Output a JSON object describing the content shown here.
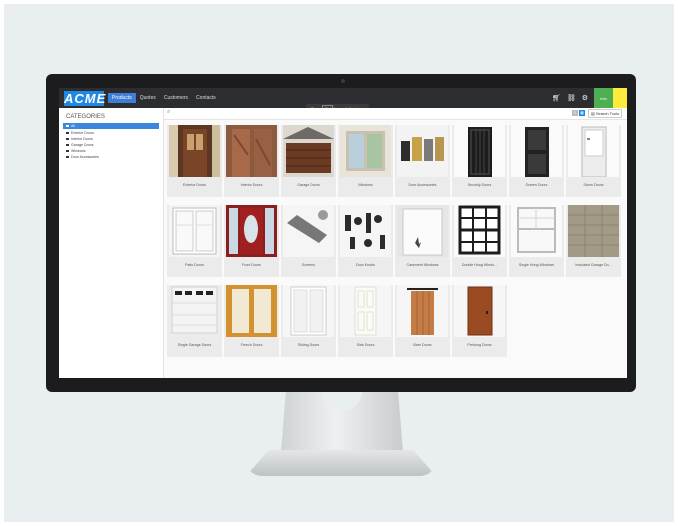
{
  "app": {
    "logo": "ACME",
    "nav": [
      "Products",
      "Quotes",
      "Customers",
      "Contacts"
    ],
    "active_nav": "Products",
    "status_label": "Info"
  },
  "tooltip": {
    "prefix": "Press",
    "key": "Ctrl",
    "suffix": "to see full a door."
  },
  "sidebar": {
    "title": "CATEGORIES",
    "items": [
      "All",
      "Exterior Doors",
      "Interior Doors",
      "Garage Doors",
      "Windows",
      "Door Accessories"
    ]
  },
  "toolbar": {
    "search_tools": "Search Tools",
    "view_list_icon": "list-icon",
    "view_grid_icon": "grid-icon"
  },
  "products": [
    "Exterior Doors",
    "Interior Doors",
    "Garage Doors",
    "Windows",
    "Door Accessories",
    "Security Doors",
    "Screen Doors",
    "Storm Doors",
    "Patio Doors",
    "Front Doors",
    "Screens",
    "Door Knobs",
    "Casement Windows",
    "Double Hung Windo...",
    "Single Hung Windows",
    "Insulated Garage Do...",
    "Single Garage Doors",
    "French Doors",
    "Sliding Doors",
    "Slab Doors",
    "Barn Doors",
    "Prehung Doors"
  ],
  "colors": {
    "accent": "#1e88e5",
    "topbar": "#2b2d31",
    "status_green": "#4caf50",
    "status_yellow": "#ffeb3b"
  }
}
